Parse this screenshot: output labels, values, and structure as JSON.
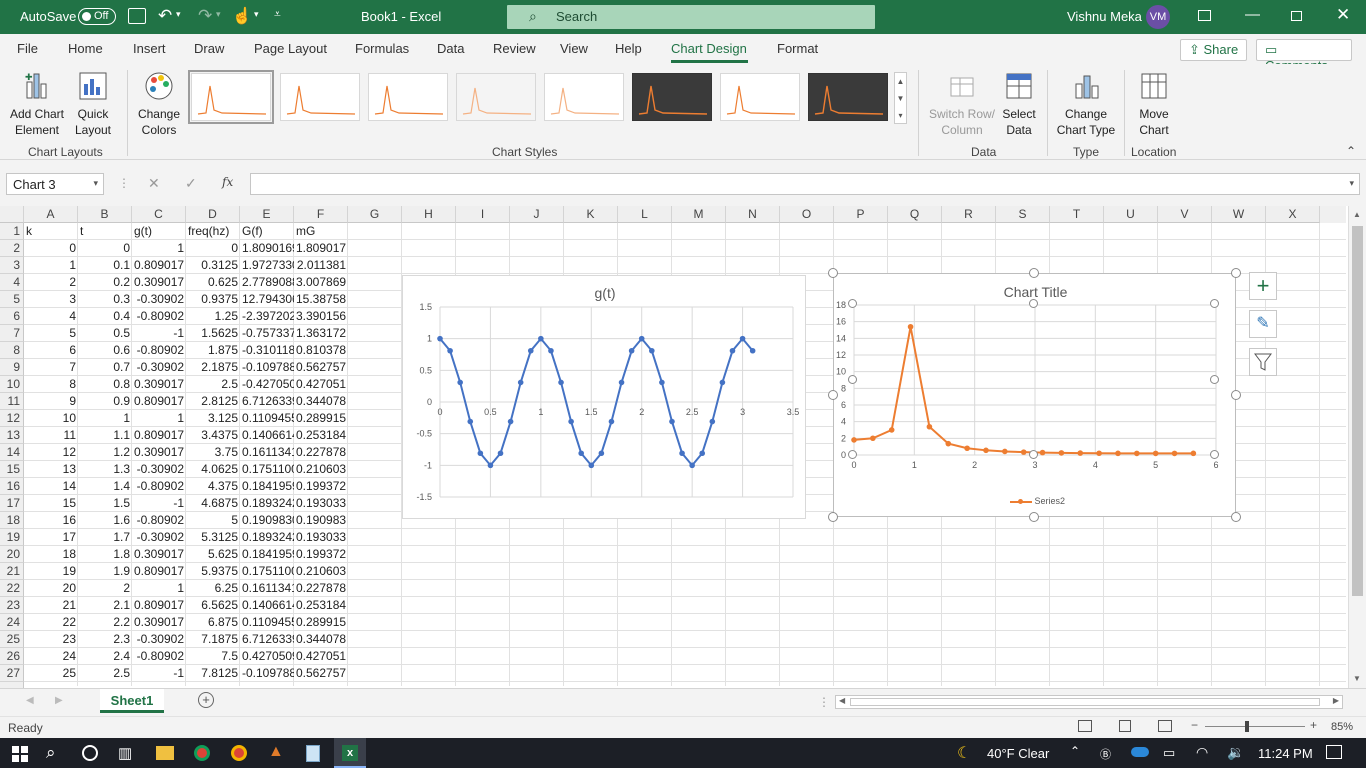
{
  "title_bar": {
    "autosave_label": "AutoSave",
    "autosave_state": "Off",
    "doc_title": "Book1  -  Excel",
    "search_placeholder": "Search",
    "user_name": "Vishnu Meka",
    "user_initials": "VM"
  },
  "tabs": [
    "File",
    "Home",
    "Insert",
    "Draw",
    "Page Layout",
    "Formulas",
    "Data",
    "Review",
    "View",
    "Help",
    "Chart Design",
    "Format"
  ],
  "active_tab": "Chart Design",
  "share_label": "Share",
  "comments_label": "Comments",
  "ribbon": {
    "add_chart_element": "Add Chart Element",
    "quick_layout": "Quick Layout",
    "change_colors": "Change Colors",
    "switch_row_column": "Switch Row/ Column",
    "select_data": "Select Data",
    "change_chart_type": "Change Chart Type",
    "move_chart": "Move Chart",
    "groups": {
      "chart_layouts": "Chart Layouts",
      "chart_styles": "Chart Styles",
      "data": "Data",
      "type": "Type",
      "location": "Location"
    }
  },
  "name_box": "Chart 3",
  "fx_label": "fx",
  "columns": [
    "A",
    "B",
    "C",
    "D",
    "E",
    "F",
    "G",
    "H",
    "I",
    "J",
    "K",
    "L",
    "M",
    "N",
    "O",
    "P",
    "Q",
    "R",
    "S",
    "T",
    "U",
    "V",
    "W",
    "X"
  ],
  "rows": [
    {
      "n": "1",
      "a": "k",
      "b": "t",
      "c": "g(t)",
      "d": "freq(hz)",
      "e": "G(f)",
      "f": "mG"
    },
    {
      "n": "2",
      "a": "0",
      "b": "0",
      "c": "1",
      "d": "0",
      "e": "1.8090169",
      "f": "1.809017"
    },
    {
      "n": "3",
      "a": "1",
      "b": "0.1",
      "c": "0.809017",
      "d": "0.3125",
      "e": "1.9727330",
      "f": "2.011381"
    },
    {
      "n": "4",
      "a": "2",
      "b": "0.2",
      "c": "0.309017",
      "d": "0.625",
      "e": "2.7789088",
      "f": "3.007869"
    },
    {
      "n": "5",
      "a": "3",
      "b": "0.3",
      "c": "-0.30902",
      "d": "0.9375",
      "e": "12.794306",
      "f": "15.38758"
    },
    {
      "n": "6",
      "a": "4",
      "b": "0.4",
      "c": "-0.80902",
      "d": "1.25",
      "e": "-2.397202:",
      "f": "3.390156"
    },
    {
      "n": "7",
      "a": "5",
      "b": "0.5",
      "c": "-1",
      "d": "1.5625",
      "e": "-0.757337",
      "f": "1.363172"
    },
    {
      "n": "8",
      "a": "6",
      "b": "0.6",
      "c": "-0.80902",
      "d": "1.875",
      "e": "-0.310118",
      "f": "0.810378"
    },
    {
      "n": "9",
      "a": "7",
      "b": "0.7",
      "c": "-0.30902",
      "d": "2.1875",
      "e": "-0.109788",
      "f": "0.562757"
    },
    {
      "n": "10",
      "a": "8",
      "b": "0.8",
      "c": "0.309017",
      "d": "2.5",
      "e": "-0.427050",
      "f": "0.427051"
    },
    {
      "n": "11",
      "a": "9",
      "b": "0.9",
      "c": "0.809017",
      "d": "2.8125",
      "e": "6.7126339",
      "f": "0.344078"
    },
    {
      "n": "12",
      "a": "10",
      "b": "1",
      "c": "1",
      "d": "3.125",
      "e": "0.1109455",
      "f": "0.289915"
    },
    {
      "n": "13",
      "a": "11",
      "b": "1.1",
      "c": "0.809017",
      "d": "3.4375",
      "e": "0.1406614",
      "f": "0.253184"
    },
    {
      "n": "14",
      "a": "12",
      "b": "1.2",
      "c": "0.309017",
      "d": "3.75",
      "e": "0.1611341",
      "f": "0.227878"
    },
    {
      "n": "15",
      "a": "13",
      "b": "1.3",
      "c": "-0.30902",
      "d": "4.0625",
      "e": "0.1751100",
      "f": "0.210603"
    },
    {
      "n": "16",
      "a": "14",
      "b": "1.4",
      "c": "-0.80902",
      "d": "4.375",
      "e": "0.1841959",
      "f": "0.199372"
    },
    {
      "n": "17",
      "a": "15",
      "b": "1.5",
      "c": "-1",
      "d": "4.6875",
      "e": "0.1893242",
      "f": "0.193033"
    },
    {
      "n": "18",
      "a": "16",
      "b": "1.6",
      "c": "-0.80902",
      "d": "5",
      "e": "0.1909830",
      "f": "0.190983"
    },
    {
      "n": "19",
      "a": "17",
      "b": "1.7",
      "c": "-0.30902",
      "d": "5.3125",
      "e": "0.1893242",
      "f": "0.193033"
    },
    {
      "n": "20",
      "a": "18",
      "b": "1.8",
      "c": "0.309017",
      "d": "5.625",
      "e": "0.1841959",
      "f": "0.199372"
    },
    {
      "n": "21",
      "a": "19",
      "b": "1.9",
      "c": "0.809017",
      "d": "5.9375",
      "e": "0.1751100",
      "f": "0.210603"
    },
    {
      "n": "22",
      "a": "20",
      "b": "2",
      "c": "1",
      "d": "6.25",
      "e": "0.1611341",
      "f": "0.227878"
    },
    {
      "n": "23",
      "a": "21",
      "b": "2.1",
      "c": "0.809017",
      "d": "6.5625",
      "e": "0.1406614",
      "f": "0.253184"
    },
    {
      "n": "24",
      "a": "22",
      "b": "2.2",
      "c": "0.309017",
      "d": "6.875",
      "e": "0.1109455",
      "f": "0.289915"
    },
    {
      "n": "25",
      "a": "23",
      "b": "2.3",
      "c": "-0.30902",
      "d": "7.1875",
      "e": "6.7126339",
      "f": "0.344078"
    },
    {
      "n": "26",
      "a": "24",
      "b": "2.4",
      "c": "-0.80902",
      "d": "7.5",
      "e": "0.4270509",
      "f": "0.427051"
    },
    {
      "n": "27",
      "a": "25",
      "b": "2.5",
      "c": "-1",
      "d": "7.8125",
      "e": "-0.109788",
      "f": "0.562757"
    }
  ],
  "chart_data": [
    {
      "type": "line",
      "title": "g(t)",
      "color": "#4472c4",
      "x": [
        0,
        0.1,
        0.2,
        0.3,
        0.4,
        0.5,
        0.6,
        0.7,
        0.8,
        0.9,
        1.0,
        1.1,
        1.2,
        1.3,
        1.4,
        1.5,
        1.6,
        1.7,
        1.8,
        1.9,
        2.0,
        2.1,
        2.2,
        2.3,
        2.4,
        2.5,
        2.6,
        2.7,
        2.8,
        2.9,
        3.0,
        3.1
      ],
      "y": [
        1,
        0.809017,
        0.309017,
        -0.30902,
        -0.80902,
        -1,
        -0.80902,
        -0.30902,
        0.309017,
        0.809017,
        1,
        0.809017,
        0.309017,
        -0.30902,
        -0.80902,
        -1,
        -0.80902,
        -0.30902,
        0.309017,
        0.809017,
        1,
        0.809017,
        0.309017,
        -0.30902,
        -0.80902,
        -1,
        -0.80902,
        -0.30902,
        0.309017,
        0.809017,
        1,
        0.809017
      ],
      "xlim": [
        0,
        3.5
      ],
      "ylim": [
        -1.5,
        1.5
      ],
      "x_ticks": [
        "0",
        "0.5",
        "1",
        "1.5",
        "2",
        "2.5",
        "3",
        "3.5"
      ],
      "y_ticks": [
        "1.5",
        "1",
        "0.5",
        "0",
        "-0.5",
        "-1",
        "-1.5"
      ],
      "grid": true
    },
    {
      "type": "scatter",
      "title": "Chart Title",
      "color": "#ed7d31",
      "legend": [
        "Series2"
      ],
      "legend_position": "bottom",
      "series": [
        {
          "name": "Series2",
          "x": [
            0,
            0.3125,
            0.625,
            0.9375,
            1.25,
            1.5625,
            1.875,
            2.1875,
            2.5,
            2.8125,
            3.125,
            3.4375,
            3.75,
            4.0625,
            4.375,
            4.6875,
            5,
            5.3125,
            5.625
          ],
          "y": [
            1.809017,
            2.011381,
            3.007869,
            15.38758,
            3.390156,
            1.363172,
            0.810378,
            0.562757,
            0.427051,
            0.344078,
            0.289915,
            0.253184,
            0.227878,
            0.210603,
            0.199372,
            0.193033,
            0.190983,
            0.193033,
            0.199372
          ]
        }
      ],
      "xlim": [
        0,
        6
      ],
      "ylim": [
        0,
        18
      ],
      "x_ticks": [
        "0",
        "1",
        "2",
        "3",
        "4",
        "5",
        "6"
      ],
      "y_ticks": [
        "18",
        "16",
        "14",
        "12",
        "10",
        "8",
        "6",
        "4",
        "2",
        "0"
      ],
      "grid": true
    }
  ],
  "sheet_tab": "Sheet1",
  "status": {
    "ready": "Ready",
    "zoom": "85%"
  },
  "taskbar": {
    "weather": "40°F  Clear",
    "time": "11:24 PM"
  }
}
